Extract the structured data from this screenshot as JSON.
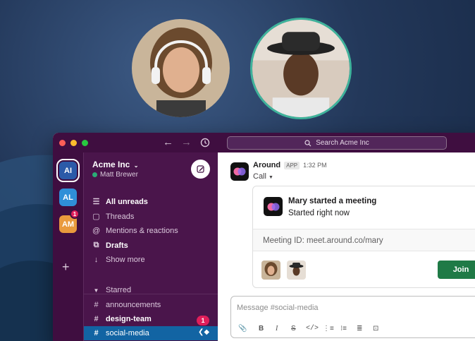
{
  "topbar": {
    "search_placeholder": "Search Acme Inc"
  },
  "workspaces": [
    {
      "initials": "AI",
      "active": true
    },
    {
      "initials": "AL"
    },
    {
      "initials": "AM",
      "badge": "1"
    }
  ],
  "sidebar": {
    "workspace_name": "Acme Inc",
    "user_name": "Matt Brewer",
    "nav": [
      {
        "label": "All unreads",
        "icon": "list-icon",
        "bold": true
      },
      {
        "label": "Threads",
        "icon": "threads-icon"
      },
      {
        "label": "Mentions & reactions",
        "icon": "at-icon"
      },
      {
        "label": "Drafts",
        "icon": "drafts-icon",
        "bold": true
      },
      {
        "label": "Show more",
        "icon": "arrow-down-icon"
      }
    ],
    "section_label": "Starred",
    "channels": [
      {
        "name": "announcements"
      },
      {
        "name": "design-team",
        "bold": true,
        "badge": "1"
      },
      {
        "name": "social-media",
        "active": true
      }
    ]
  },
  "message": {
    "sender": "Around",
    "tag": "APP",
    "time": "1:32 PM",
    "subtitle": "Call",
    "card": {
      "title": "Mary started a meeting",
      "subtitle": "Started right now",
      "meeting_id": "Meeting ID: meet.around.co/mary",
      "join_label": "Join"
    }
  },
  "composer": {
    "placeholder": "Message #social-media"
  },
  "colors": {
    "aubergine": "#4a154b",
    "rail": "#3f0e40",
    "active_channel": "#1264a3",
    "join": "#1f7a46",
    "badge": "#e01e5a"
  }
}
